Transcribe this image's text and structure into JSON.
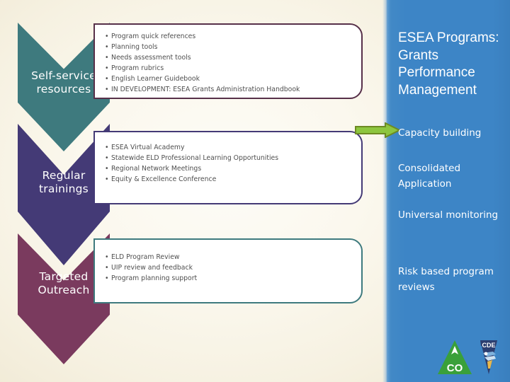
{
  "slide": {
    "background_color": "#f4efdf",
    "panel_color": "#3d85c6"
  },
  "stages": [
    {
      "label": "Self-service\nresources",
      "label_line1": "Self-service",
      "label_line2": "resources",
      "color": "#3e7a7e",
      "box_border_color": "#573049",
      "items": [
        "Program quick references",
        "Planning tools",
        "Needs assessment tools",
        "Program rubrics",
        "English Learner Guidebook",
        "IN DEVELOPMENT: ESEA Grants Administration Handbook"
      ]
    },
    {
      "label": "Regular\ntrainings",
      "label_line1": "Regular",
      "label_line2": "trainings",
      "color": "#443a76",
      "box_border_color": "#443a76",
      "items": [
        "ESEA Virtual Academy",
        "Statewide ELD  Professional Learning Opportunities",
        "Regional Network Meetings",
        "Equity & Excellence Conference"
      ]
    },
    {
      "label": "Targeted\nOutreach",
      "label_line1": "Targeted",
      "label_line2": "Outreach",
      "color": "#7a3a5e",
      "box_border_color": "#3e7a7e",
      "items": [
        "ELD Program Review",
        "UIP review and feedback",
        "Program planning support"
      ]
    }
  ],
  "panel": {
    "title": "ESEA Programs: Grants Performance Management",
    "items": [
      "Capacity building",
      "Consolidated Application",
      "Universal monitoring",
      "Risk based program reviews"
    ],
    "arrow_color": "#8dc63f",
    "arrow_border_color": "#6d8a22"
  },
  "logo": {
    "name": "colorado-department-of-education-logo",
    "co_text": "CO",
    "cde_text": "CDE",
    "co_color": "#3aa03a",
    "cde_color": "#2c3e70"
  }
}
